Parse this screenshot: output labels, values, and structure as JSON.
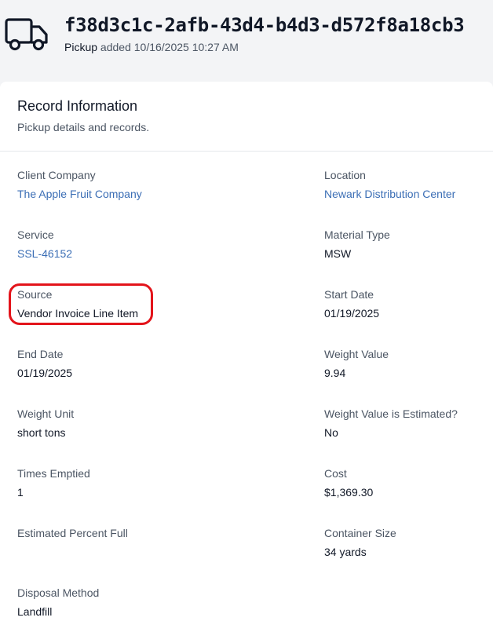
{
  "header": {
    "record_id": "f38d3c1c-2afb-43d4-b4d3-d572f8a18cb3",
    "record_type": "Pickup",
    "added_text": "added 10/16/2025 10:27 AM",
    "icon": "truck-icon"
  },
  "card": {
    "title": "Record Information",
    "subtitle": "Pickup details and records."
  },
  "fields": {
    "client_company": {
      "label": "Client Company",
      "value": "The Apple Fruit Company"
    },
    "location": {
      "label": "Location",
      "value": "Newark Distribution Center"
    },
    "service": {
      "label": "Service",
      "value": "SSL-46152"
    },
    "material_type": {
      "label": "Material Type",
      "value": "MSW"
    },
    "source": {
      "label": "Source",
      "value": "Vendor Invoice Line Item"
    },
    "start_date": {
      "label": "Start Date",
      "value": "01/19/2025"
    },
    "end_date": {
      "label": "End Date",
      "value": "01/19/2025"
    },
    "weight_value": {
      "label": "Weight Value",
      "value": "9.94"
    },
    "weight_unit": {
      "label": "Weight Unit",
      "value": "short tons"
    },
    "weight_estimated": {
      "label": "Weight Value is Estimated?",
      "value": "No"
    },
    "times_emptied": {
      "label": "Times Emptied",
      "value": "1"
    },
    "cost": {
      "label": "Cost",
      "value": "$1,369.30"
    },
    "estimated_percent_full": {
      "label": "Estimated Percent Full",
      "value": ""
    },
    "container_size": {
      "label": "Container Size",
      "value": "34 yards"
    },
    "disposal_method": {
      "label": "Disposal Method",
      "value": "Landfill"
    }
  },
  "colors": {
    "link": "#3b6eb5",
    "highlight": "#e3141b",
    "background": "#f3f4f6"
  }
}
